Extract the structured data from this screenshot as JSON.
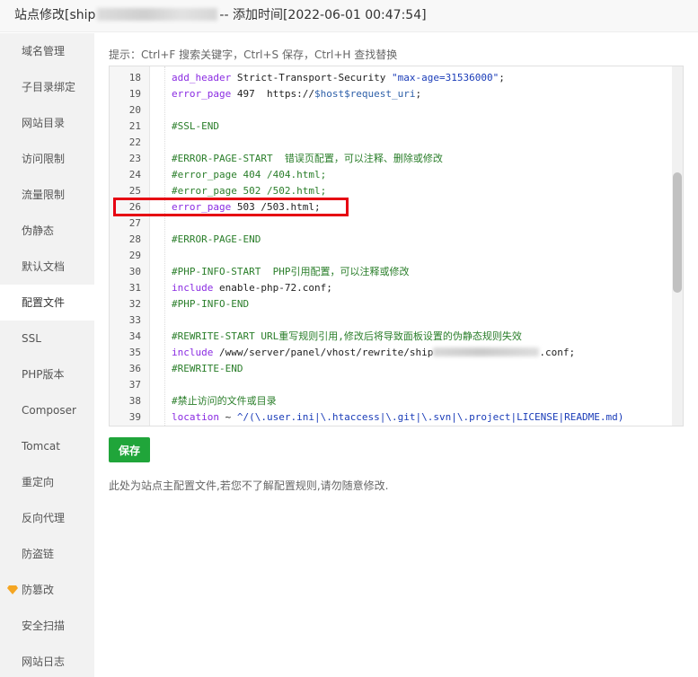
{
  "title": {
    "prefix": "站点修改[ship",
    "suffix": "-- 添加时间[2022-06-01 00:47:54]"
  },
  "sidebar": {
    "items": [
      {
        "label": "域名管理"
      },
      {
        "label": "子目录绑定"
      },
      {
        "label": "网站目录"
      },
      {
        "label": "访问限制"
      },
      {
        "label": "流量限制"
      },
      {
        "label": "伪静态"
      },
      {
        "label": "默认文档"
      },
      {
        "label": "配置文件",
        "active": true
      },
      {
        "label": "SSL"
      },
      {
        "label": "PHP版本"
      },
      {
        "label": "Composer"
      },
      {
        "label": "Tomcat"
      },
      {
        "label": "重定向"
      },
      {
        "label": "反向代理"
      },
      {
        "label": "防盗链"
      },
      {
        "label": "防篡改",
        "icon": "gem-icon"
      },
      {
        "label": "安全扫描"
      },
      {
        "label": "网站日志"
      }
    ]
  },
  "hint": "提示：Ctrl+F 搜索关键字，Ctrl+S 保存，Ctrl+H 查找替换",
  "editor": {
    "lines": [
      {
        "num": "18",
        "parts": [
          [
            "dir",
            "add_header"
          ],
          [
            "txt",
            " Strict-Transport-Security "
          ],
          [
            "str",
            "\"max-age=31536000\""
          ],
          [
            "txt",
            ";"
          ]
        ]
      },
      {
        "num": "19",
        "parts": [
          [
            "dir",
            "error_page"
          ],
          [
            "txt",
            " 497  https://"
          ],
          [
            "var",
            "$host$request_uri"
          ],
          [
            "txt",
            ";"
          ]
        ]
      },
      {
        "num": "20",
        "parts": []
      },
      {
        "num": "21",
        "parts": [
          [
            "com",
            "#SSL-END"
          ]
        ]
      },
      {
        "num": "22",
        "parts": []
      },
      {
        "num": "23",
        "parts": [
          [
            "com",
            "#ERROR-PAGE-START  错误页配置，可以注释、删除或修改"
          ]
        ]
      },
      {
        "num": "24",
        "parts": [
          [
            "com",
            "#error_page 404 /404.html;"
          ]
        ]
      },
      {
        "num": "25",
        "parts": [
          [
            "com",
            "#error_page 502 /502.html;"
          ]
        ]
      },
      {
        "num": "26",
        "parts": [
          [
            "dir",
            "error_page"
          ],
          [
            "txt",
            " 503 /503.html;"
          ]
        ]
      },
      {
        "num": "27",
        "parts": []
      },
      {
        "num": "28",
        "parts": [
          [
            "com",
            "#ERROR-PAGE-END"
          ]
        ]
      },
      {
        "num": "29",
        "parts": []
      },
      {
        "num": "30",
        "parts": [
          [
            "com",
            "#PHP-INFO-START  PHP引用配置，可以注释或修改"
          ]
        ]
      },
      {
        "num": "31",
        "parts": [
          [
            "dir",
            "include"
          ],
          [
            "txt",
            " enable-php-72.conf;"
          ]
        ]
      },
      {
        "num": "32",
        "parts": [
          [
            "com",
            "#PHP-INFO-END"
          ]
        ]
      },
      {
        "num": "33",
        "parts": []
      },
      {
        "num": "34",
        "parts": [
          [
            "com",
            "#REWRITE-START URL重写规则引用,修改后将导致面板设置的伪静态规则失效"
          ]
        ]
      },
      {
        "num": "35",
        "parts": [
          [
            "dir",
            "include"
          ],
          [
            "txt",
            " /www/server/panel/vhost/rewrite/ship"
          ],
          [
            "blur",
            ""
          ],
          [
            "txt",
            ".conf;"
          ]
        ]
      },
      {
        "num": "36",
        "parts": [
          [
            "com",
            "#REWRITE-END"
          ]
        ]
      },
      {
        "num": "37",
        "parts": []
      },
      {
        "num": "38",
        "parts": [
          [
            "com",
            "#禁止访问的文件或目录"
          ]
        ]
      },
      {
        "num": "39",
        "parts": [
          [
            "dir",
            "location"
          ],
          [
            "txt",
            " ~ "
          ],
          [
            "str",
            "^/(\\.user.ini|\\.htaccess|\\.git|\\.svn|\\.project|LICENSE|README.md)"
          ]
        ]
      }
    ]
  },
  "save_button": "保存",
  "note": "此处为站点主配置文件,若您不了解配置规则,请勿随意修改.",
  "colors": {
    "accent": "#20a53a",
    "highlight": "#e60012",
    "directive": "#8a2be2",
    "comment": "#2a7e2a",
    "string": "#1a3cb8"
  }
}
